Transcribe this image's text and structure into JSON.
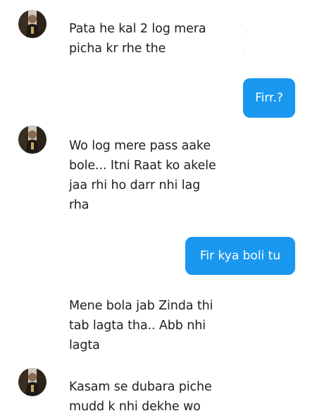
{
  "messages": [
    {
      "side": "received",
      "lines": "Pata he kal 2 log mera\npicha kr rhe the"
    },
    {
      "side": "sent",
      "text": "Firr.?"
    },
    {
      "side": "received",
      "lines": "Wo log mere pass aake\nbole... Itni Raat ko akele\njaa rhi ho darr nhi lag\nrha"
    },
    {
      "side": "sent",
      "text": "Fir kya boli tu"
    },
    {
      "side": "received",
      "lines": "Mene bola jab Zinda thi\ntab lagta tha.. Abb nhi\nlagta"
    },
    {
      "side": "received",
      "lines": "Kasam se dubara piche\nmudd k nhi dekhe wo"
    }
  ],
  "colors": {
    "sent_bubble": "#1a98f0",
    "sent_text": "#ffffff",
    "received_text": "#1f1f1f",
    "background": "#ffffff"
  },
  "icons": {
    "avatar": "profile-picture-icon"
  }
}
